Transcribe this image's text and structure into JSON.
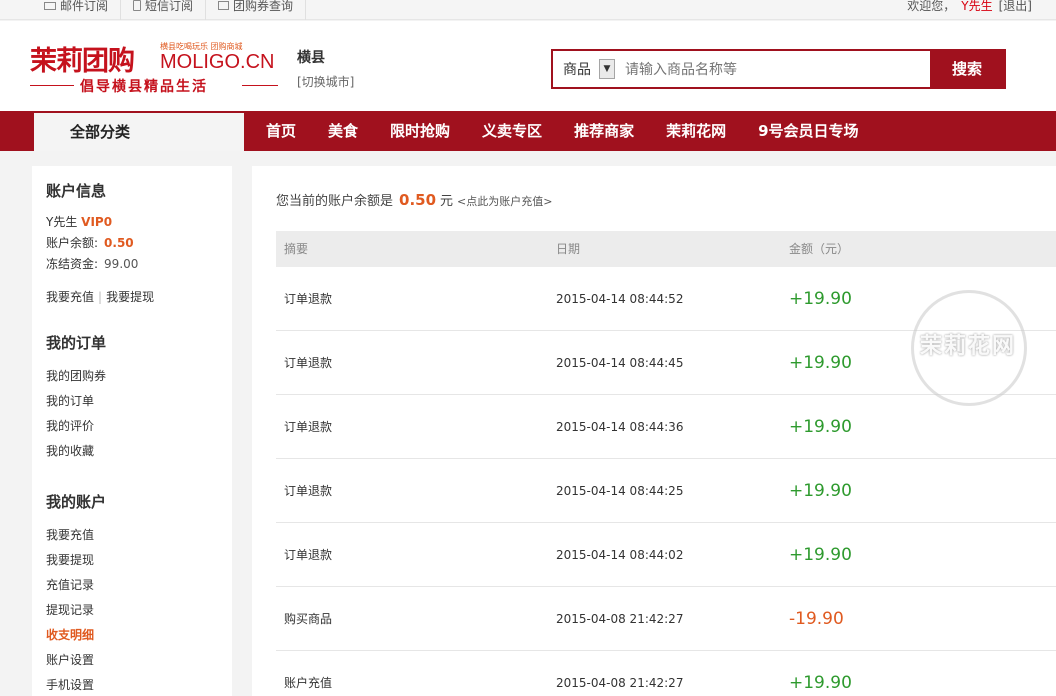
{
  "topbar": {
    "links": [
      {
        "label": "邮件订阅",
        "icon": "mail-icon"
      },
      {
        "label": "短信订阅",
        "icon": "phone-icon"
      },
      {
        "label": "团购券查询",
        "icon": "ticket-icon"
      }
    ],
    "welcome": "欢迎您，",
    "user": "Y先生",
    "logout": "[退出]"
  },
  "header": {
    "logo_cn": "茉莉团购",
    "logo_en": "MOLIGO.CN",
    "logo_tagline": "横县吃喝玩乐 团购商城",
    "logo_slogan": "倡导横县精品生活",
    "city": "横县",
    "switch_city": "[切换城市]"
  },
  "search": {
    "category": "商品",
    "placeholder": "请输入商品名称等",
    "button": "搜索"
  },
  "nav": {
    "all_categories": "全部分类",
    "items": [
      "首页",
      "美食",
      "限时抢购",
      "义卖专区",
      "推荐商家",
      "茉莉花网",
      "9号会员日专场"
    ]
  },
  "sidebar": {
    "account_title": "账户信息",
    "user_name": "Y先生",
    "vip": "VIP0",
    "balance_label": "账户余额:",
    "balance_value": "0.50",
    "frozen_label": "冻结资金:",
    "frozen_value": "99.00",
    "recharge": "我要充值",
    "withdraw": "我要提现",
    "orders_title": "我的订单",
    "orders": [
      "我的团购券",
      "我的订单",
      "我的评价",
      "我的收藏"
    ],
    "myaccount_title": "我的账户",
    "myaccount": [
      {
        "label": "我要充值",
        "active": false
      },
      {
        "label": "我要提现",
        "active": false
      },
      {
        "label": "充值记录",
        "active": false
      },
      {
        "label": "提现记录",
        "active": false
      },
      {
        "label": "收支明细",
        "active": true
      },
      {
        "label": "账户设置",
        "active": false
      },
      {
        "label": "手机设置",
        "active": false
      }
    ]
  },
  "main": {
    "balance_prefix": "您当前的账户余额是",
    "balance_amount": "0.50",
    "balance_unit": "元",
    "recharge_link": "<点此为账户充值>",
    "columns": [
      "摘要",
      "日期",
      "金额（元）"
    ],
    "rows": [
      {
        "summary": "订单退款",
        "date": "2015-04-14 08:44:52",
        "amount": "+19.90",
        "type": "income"
      },
      {
        "summary": "订单退款",
        "date": "2015-04-14 08:44:45",
        "amount": "+19.90",
        "type": "income"
      },
      {
        "summary": "订单退款",
        "date": "2015-04-14 08:44:36",
        "amount": "+19.90",
        "type": "income"
      },
      {
        "summary": "订单退款",
        "date": "2015-04-14 08:44:25",
        "amount": "+19.90",
        "type": "income"
      },
      {
        "summary": "订单退款",
        "date": "2015-04-14 08:44:02",
        "amount": "+19.90",
        "type": "income"
      },
      {
        "summary": "购买商品",
        "date": "2015-04-08 21:42:27",
        "amount": "-19.90",
        "type": "expense"
      },
      {
        "summary": "账户充值",
        "date": "2015-04-08 21:42:27",
        "amount": "+19.90",
        "type": "income"
      }
    ]
  },
  "watermark": {
    "text": "茉莉花网"
  },
  "colors": {
    "brand_red": "#a0111e",
    "logo_red": "#c5121d",
    "income_green": "#2e9a2e",
    "expense_orange": "#e05a20"
  }
}
